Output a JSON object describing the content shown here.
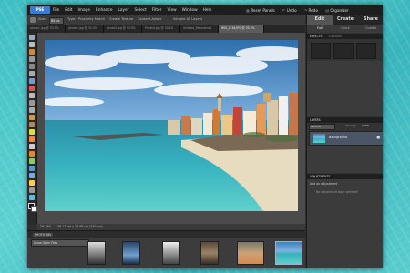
{
  "app": {
    "logo_text": "PSE"
  },
  "menu": [
    "File",
    "Edit",
    "Image",
    "Enhance",
    "Layer",
    "Select",
    "Filter",
    "View",
    "Window",
    "Help"
  ],
  "topbar": {
    "reset_panels": "Reset Panels",
    "undo": "Undo",
    "redo": "Redo",
    "organizer": "Organizer"
  },
  "tool_options": {
    "size_label": "Size:",
    "size_value": "80 px",
    "type_label": "Type:",
    "proximity": "Proximity Match",
    "create_texture": "Create Texture",
    "content_aware": "Content-Aware",
    "sample_all": "Sample All Layers"
  },
  "doc_tabs": [
    "photo1.jpg @ 33.3%",
    "photo2.jpg @ 33.3%",
    "photo3.jpg @ 33.3%",
    "Photo4.jpg @ 33.3%",
    "Untitled_Panorama1",
    "IMG_1234.JPG @ 33.3%"
  ],
  "status": {
    "zoom": "26.19%",
    "doc_info": "36.12 cm x 24.08 cm (240 ppi)"
  },
  "photo_bin": {
    "label": "PHOTO BIN",
    "select_value": "Show Open Files"
  },
  "modes": {
    "edit": "Edit",
    "create": "Create",
    "share": "Share"
  },
  "sub_tabs": {
    "full": "Full",
    "quick": "Quick",
    "guided": "Guided"
  },
  "panels": {
    "effects": {
      "title": "EFFECTS",
      "tab2": "CONTENT"
    },
    "layers": {
      "title": "LAYERS",
      "blend_mode": "Normal",
      "opacity_label": "Opacity:",
      "opacity_value": "100%",
      "background_layer": "Background"
    },
    "adjustments": {
      "title": "ADJUSTMENTS",
      "add_text": "Add an adjustment",
      "no_layer": "No adjustment layer selected"
    }
  },
  "colors": {
    "accent": "#3a7bd5",
    "panel_bg": "#333333",
    "sea": "#2fa3b6",
    "sky": "#3f7fbf"
  }
}
